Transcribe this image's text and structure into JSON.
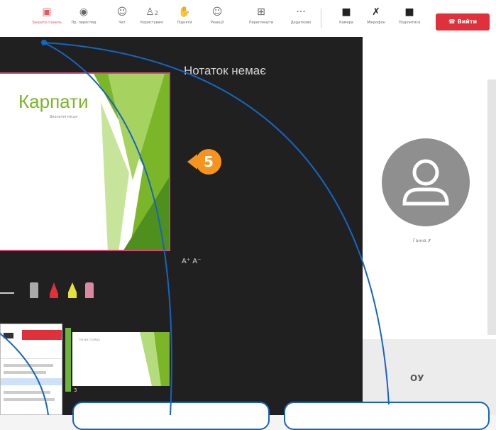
{
  "toolbar": {
    "items": [
      {
        "label": "Закрити панель",
        "icon": "present-icon"
      },
      {
        "label": "Пр. перегляд",
        "icon": "eye-icon"
      },
      {
        "label": "Чат",
        "icon": "chat-icon"
      },
      {
        "label": "Користувачі",
        "icon": "users-icon"
      },
      {
        "label": "Підняти",
        "icon": "hand-icon"
      },
      {
        "label": "Реакції",
        "icon": "smile-icon"
      },
      {
        "label": "Переглянути",
        "icon": "grid-icon"
      },
      {
        "label": "Додатково",
        "icon": "more-icon"
      },
      {
        "label": "Камера",
        "icon": "camera-icon"
      },
      {
        "label": "Мікрофон",
        "icon": "mic-icon"
      },
      {
        "label": "Поділитися",
        "icon": "share-icon"
      }
    ],
    "users_count": "2",
    "leave_label": "Вийти"
  },
  "slide": {
    "title": "Карпати",
    "subtitle": "Визначні місця"
  },
  "notes": {
    "empty_text": "Нотаток немає",
    "font_size_controls": "A⁺  A⁻"
  },
  "marker_number": "5",
  "thumbnail": {
    "number": "3",
    "title": "Назва слайда"
  },
  "participant": {
    "name": "Ганна"
  },
  "bottom_panel": {
    "initials": "ОУ"
  },
  "colors": {
    "accent_red": "#e0303a",
    "marker_orange": "#f7941d",
    "callout_blue": "#1565c0",
    "slide_green": "#7bb528",
    "dark_bg": "#202020"
  }
}
